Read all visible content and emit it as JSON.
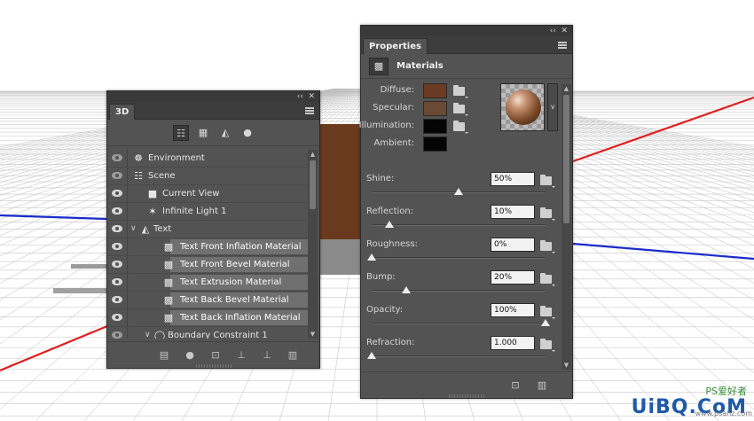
{
  "panel3d": {
    "tab_label": "3D",
    "collapse_glyph": "‹‹",
    "close_glyph": "✕",
    "filters": [
      {
        "name": "filter-whole-scene-icon",
        "glyph": "☷",
        "active": true
      },
      {
        "name": "filter-meshes-icon",
        "glyph": "▦",
        "active": false
      },
      {
        "name": "filter-materials-icon",
        "glyph": "◭",
        "active": false
      },
      {
        "name": "filter-lights-icon",
        "glyph": "●",
        "active": false
      }
    ],
    "layers": [
      {
        "label": "Environment",
        "icon": "environment-icon",
        "glyph": "☸",
        "indent": 0,
        "twisty": "",
        "selected": false,
        "eye_dim": true
      },
      {
        "label": "Scene",
        "icon": "scene-icon",
        "glyph": "☷",
        "indent": 0,
        "twisty": "",
        "selected": false,
        "eye_dim": true
      },
      {
        "label": "Current View",
        "icon": "camera-icon",
        "glyph": "■",
        "indent": 1,
        "twisty": "",
        "selected": false,
        "eye_dim": false
      },
      {
        "label": "Infinite Light 1",
        "icon": "light-icon",
        "glyph": "✶",
        "indent": 1,
        "twisty": "",
        "selected": false,
        "eye_dim": false
      },
      {
        "label": "Text",
        "icon": "mesh-icon",
        "glyph": "◭",
        "indent": 0,
        "twisty": "∨",
        "selected": false,
        "eye_dim": false
      },
      {
        "label": "Text Front Inflation Material",
        "icon": "material-icon",
        "glyph": "▩",
        "indent": 2,
        "twisty": "",
        "selected": true,
        "eye_dim": false
      },
      {
        "label": "Text Front Bevel Material",
        "icon": "material-icon",
        "glyph": "▩",
        "indent": 2,
        "twisty": "",
        "selected": true,
        "eye_dim": false
      },
      {
        "label": "Text Extrusion Material",
        "icon": "material-icon",
        "glyph": "▩",
        "indent": 2,
        "twisty": "",
        "selected": true,
        "eye_dim": false
      },
      {
        "label": "Text Back Bevel Material",
        "icon": "material-icon",
        "glyph": "▩",
        "indent": 2,
        "twisty": "",
        "selected": true,
        "eye_dim": false
      },
      {
        "label": "Text Back Inflation Material",
        "icon": "material-icon",
        "glyph": "▩",
        "indent": 2,
        "twisty": "",
        "selected": true,
        "eye_dim": false
      },
      {
        "label": "Boundary Constraint 1",
        "icon": "constraint-icon",
        "glyph": "◯",
        "indent": 1,
        "twisty": "∨",
        "selected": false,
        "eye_dim": true
      }
    ],
    "bottom_icons": [
      {
        "name": "render-icon",
        "glyph": "▤"
      },
      {
        "name": "add-light-icon",
        "glyph": "●"
      },
      {
        "name": "drop-to-plane-icon",
        "glyph": "⊡"
      },
      {
        "name": "add-constraint-icon",
        "glyph": "⊥"
      },
      {
        "name": "move-to-ground-icon",
        "glyph": "⊥"
      },
      {
        "name": "trash-icon",
        "glyph": "▥"
      }
    ]
  },
  "properties": {
    "tab_label": "Properties",
    "collapse_glyph": "‹‹",
    "close_glyph": "✕",
    "section_label": "Materials",
    "swatches": [
      {
        "label": "Diffuse:",
        "color": "#6b3a22"
      },
      {
        "label": "Specular:",
        "color": "#6a4a33"
      },
      {
        "label": "Illumination:",
        "color": "#050505"
      },
      {
        "label": "Ambient:",
        "color": "#050505"
      }
    ],
    "sliders": [
      {
        "label": "Shine:",
        "value": "50%",
        "position": 0.5
      },
      {
        "label": "Reflection:",
        "value": "10%",
        "position": 0.1
      },
      {
        "label": "Roughness:",
        "value": "0%",
        "position": 0.0
      },
      {
        "label": "Bump:",
        "value": "20%",
        "position": 0.2
      },
      {
        "label": "Opacity:",
        "value": "100%",
        "position": 1.0
      },
      {
        "label": "Refraction:",
        "value": "1.000",
        "position": 0.0
      }
    ],
    "bottom_icons": [
      {
        "name": "new-material-icon",
        "glyph": "⊡"
      },
      {
        "name": "trash-icon",
        "glyph": "▥"
      }
    ]
  },
  "watermark": {
    "top_text": "PS爱好者",
    "main_text": "UiBQ.CoM",
    "sub_text": "www.psahz.com"
  },
  "colors": {
    "panel_bg": "#535353",
    "axis_red": "#e02020",
    "axis_blue": "#1a2bcc"
  }
}
